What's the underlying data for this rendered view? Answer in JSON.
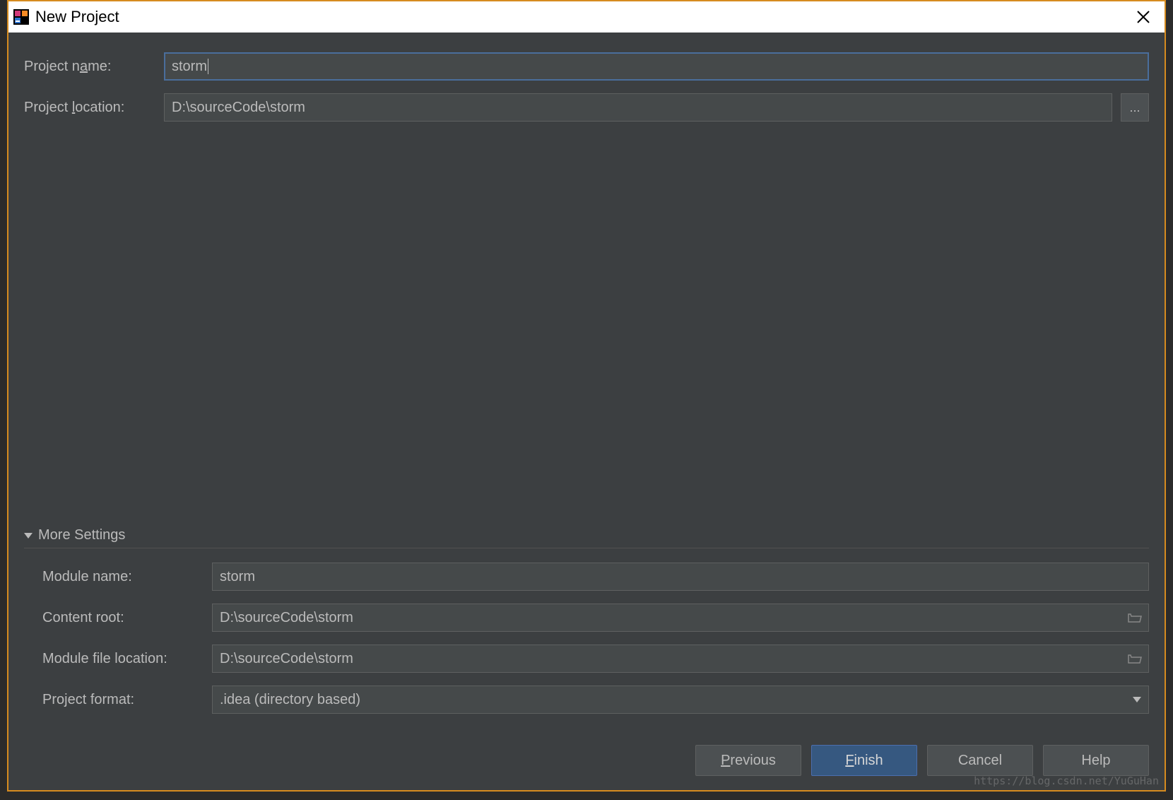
{
  "window": {
    "title": "New Project"
  },
  "form": {
    "project_name_label": "Project name:",
    "project_name_value": "storm",
    "project_location_label": "Project location:",
    "project_location_value": "D:\\sourceCode\\storm",
    "browse_label": "..."
  },
  "more_settings": {
    "header": "More Settings",
    "module_name_label": "Module name:",
    "module_name_value": "storm",
    "content_root_label": "Content root:",
    "content_root_value": "D:\\sourceCode\\storm",
    "module_file_location_label": "Module file location:",
    "module_file_location_value": "D:\\sourceCode\\storm",
    "project_format_label": "Project format:",
    "project_format_value": ".idea (directory based)"
  },
  "buttons": {
    "previous": "Previous",
    "finish": "Finish",
    "cancel": "Cancel",
    "help": "Help"
  },
  "watermark": "https://blog.csdn.net/YuGuHan"
}
